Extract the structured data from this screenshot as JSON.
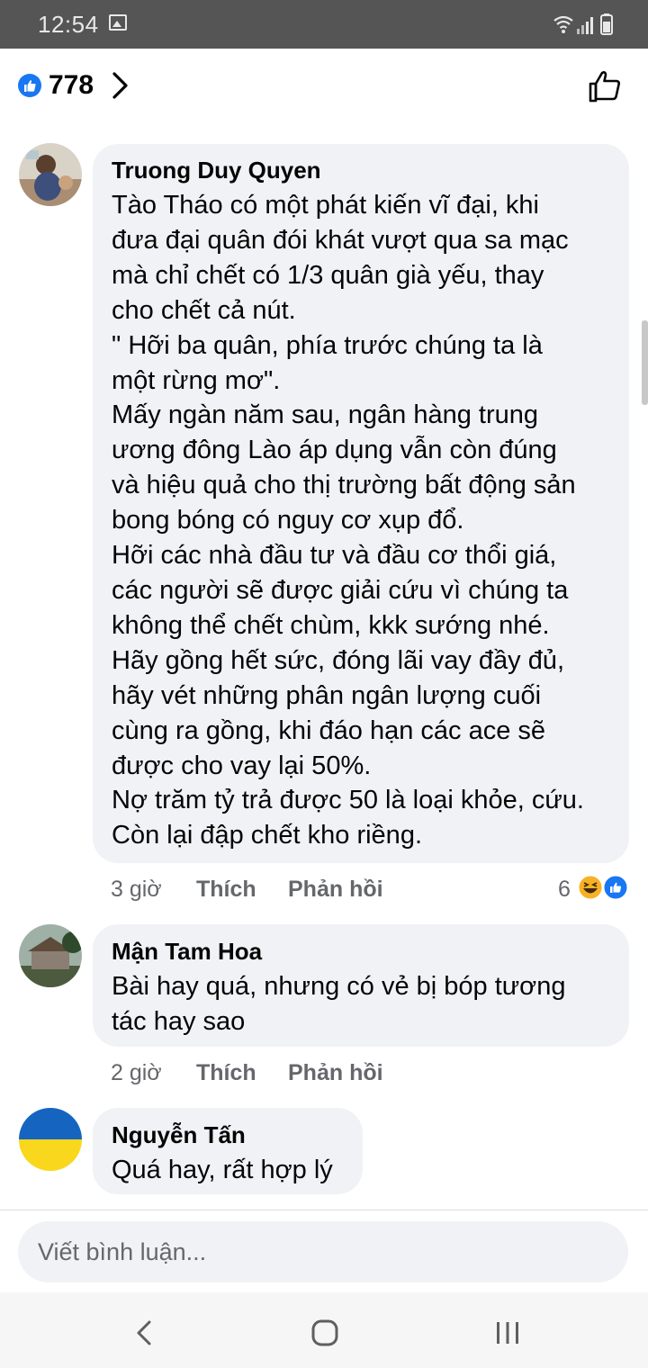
{
  "status_bar": {
    "time": "12:54"
  },
  "header": {
    "like_count": "778"
  },
  "comments": [
    {
      "author": "Truong Duy Quyen",
      "text": "Tào Tháo có một phát kiến vĩ đại, khi\nđưa đại quân đói khát vượt qua sa mạc\nmà chỉ chết có 1/3 quân già yếu, thay\ncho chết cả nút.\n\" Hỡi ba quân, phía trước chúng ta là\nmột rừng mơ\".\nMấy ngàn năm sau, ngân hàng trung\nương đông Lào áp dụng vẫn còn đúng\nvà hiệu quả cho thị trường bất động sản\nbong bóng có nguy cơ xụp đổ.\nHỡi các nhà đầu tư và đầu cơ thổi giá,\ncác người sẽ được giải cứu vì chúng ta\nkhông thể chết chùm, kkk sướng nhé.\nHãy gồng hết sức, đóng lãi vay đầy đủ,\nhãy vét những phân ngân lượng cuối\ncùng ra gồng, khi đáo hạn các ace sẽ\nđược cho vay lại 50%.\nNợ trăm tỷ trả được 50 là loại khỏe, cứu.\nCòn lại đập chết kho riềng.",
      "time": "3 giờ",
      "like_label": "Thích",
      "reply_label": "Phản hồi",
      "reaction_count": "6"
    },
    {
      "author": "Mận Tam Hoa",
      "text": "Bài hay quá, nhưng có vẻ bị bóp tương\ntác hay sao",
      "time": "2 giờ",
      "like_label": "Thích",
      "reply_label": "Phản hồi"
    },
    {
      "author": "Nguyễn Tấn",
      "text": "Quá hay, rất hợp lý"
    }
  ],
  "composer": {
    "placeholder": "Viết bình luận..."
  },
  "colors": {
    "accent": "#1877f2",
    "bubble": "#f0f2f5",
    "meta": "#65676b",
    "laugh": "#f7b125"
  }
}
